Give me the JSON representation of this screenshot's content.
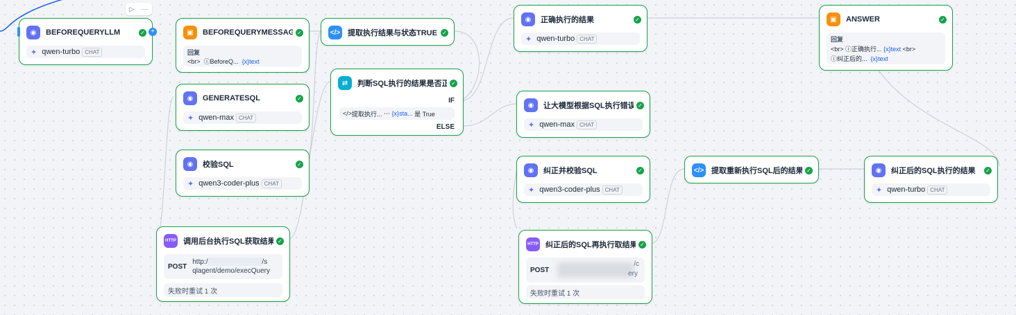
{
  "toolbar": {
    "run_icon": "play-icon",
    "more_icon": "more-icon"
  },
  "labels": {
    "chat": "CHAT",
    "reply": "回复",
    "br": "<br>",
    "if": "IF",
    "else": "ELSE",
    "post": "POST"
  },
  "nodes": {
    "beforequeryllm": {
      "title": "BEFOREQUERYLLM",
      "model": "qwen-turbo"
    },
    "beforequerymessage": {
      "title": "BEFOREQUERYMESSAGE",
      "var_node": "BeforeQ...",
      "var_field": "text"
    },
    "generatesql": {
      "title": "GENERATESQL",
      "model": "qwen-max"
    },
    "verifysql": {
      "title": "校验SQL",
      "model": "qwen3-coder-plus"
    },
    "call_backend": {
      "title": "调用后台执行SQL获取结果",
      "url": "http:/",
      "url_tail": "/s",
      "url_line2": "qlagent/demo/execQuery",
      "retry": "失败时重试 1 次"
    },
    "extract_status": {
      "title": "提取执行结果与状态TRUE OR"
    },
    "judge_sql": {
      "title": "判断SQL执行的结果是否正确",
      "cond_var": "提取执行...",
      "cond_field": "sta...",
      "cond_op": "是 True"
    },
    "correct_result": {
      "title": "正确执行的结果",
      "model": "qwen-turbo"
    },
    "model_fix": {
      "title": "让大模型根据SQL执行错误",
      "model": "qwen-max"
    },
    "fix_verify": {
      "title": "纠正并校验SQL",
      "model": "qwen3-coder-plus"
    },
    "rerun_fixed": {
      "title": "纠正后的SQL再执行取结果",
      "url_tail": "/c",
      "url_line2_tail": "ery",
      "retry": "失败时重试 1 次"
    },
    "extract_rerun": {
      "title": "提取重新执行SQL后的结果"
    },
    "fixed_result": {
      "title": "纠正后的SQL执行的结果",
      "model": "qwen-turbo"
    },
    "answer": {
      "title": "ANSWER",
      "var1": "正确执行...",
      "var2": "纠正后的...",
      "field": "text"
    }
  },
  "colors": {
    "success": "#16a34a",
    "edge": "#d0d5dd",
    "edge_active": "#155eef"
  }
}
